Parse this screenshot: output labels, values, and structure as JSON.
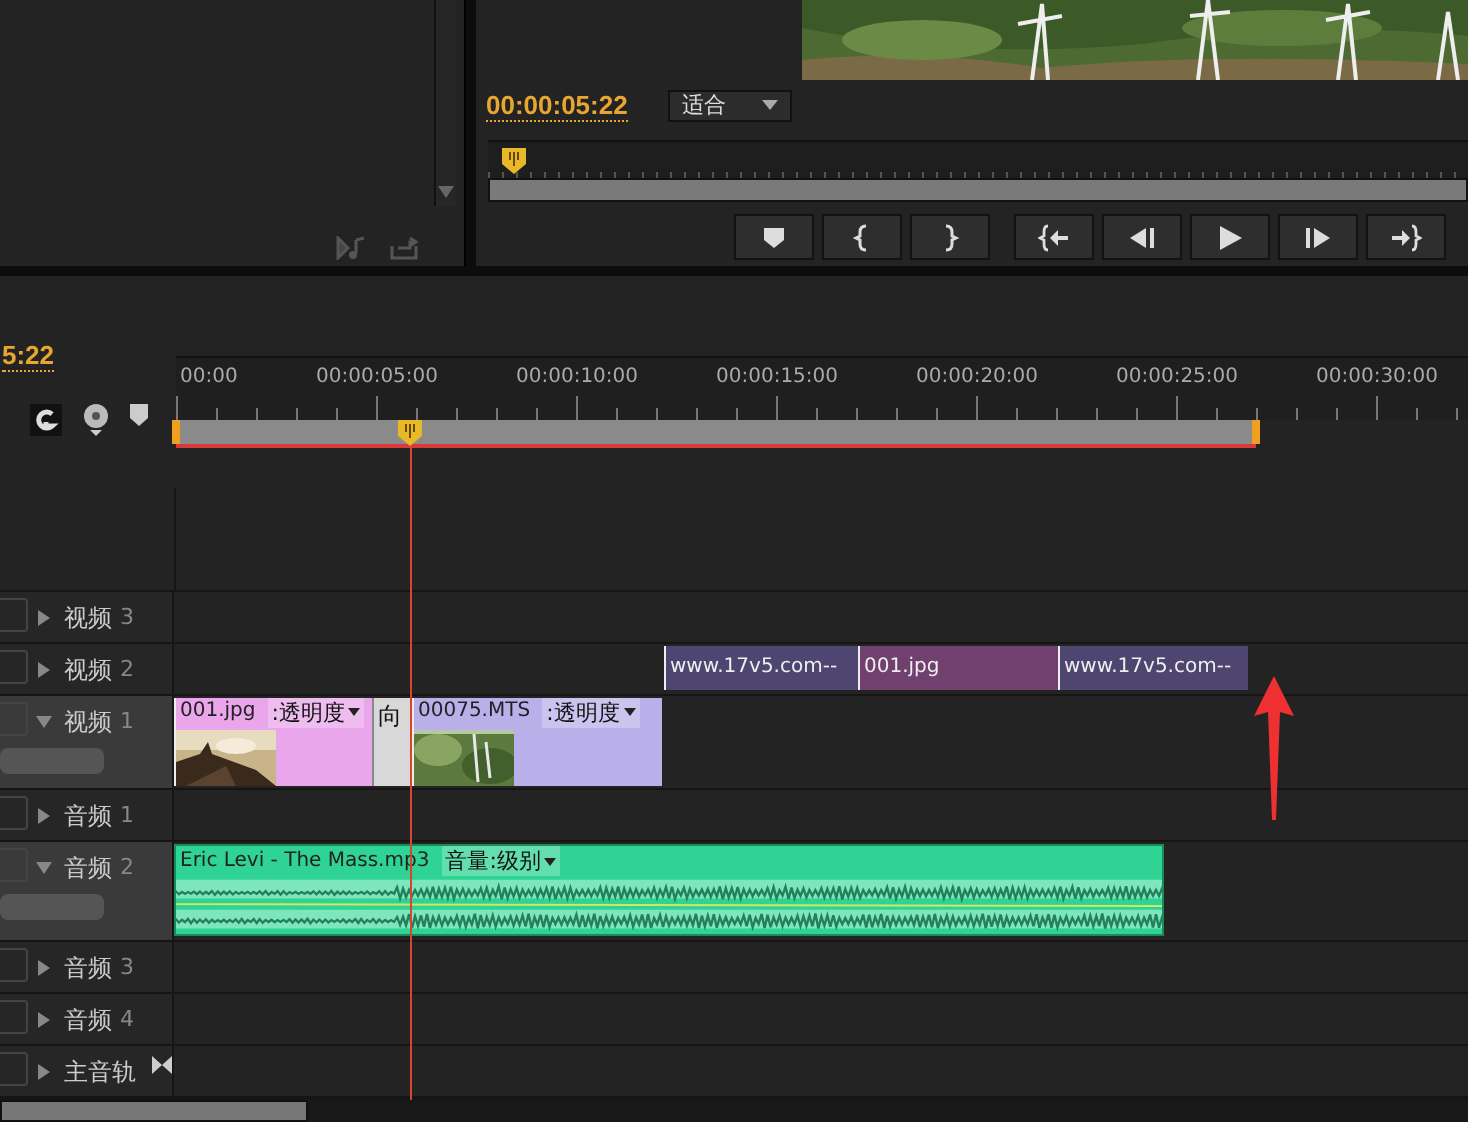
{
  "program_monitor": {
    "timecode": "00:00:05:22",
    "zoom_select": "适合",
    "playhead": {
      "level": 0.015
    },
    "transport_buttons": [
      {
        "kind": "marker"
      },
      {
        "kind": "mark-in"
      },
      {
        "kind": "mark-out"
      },
      {
        "kind": "go-to-in"
      },
      {
        "kind": "step-back"
      },
      {
        "kind": "play"
      },
      {
        "kind": "step-forward"
      },
      {
        "kind": "go-to-out"
      }
    ]
  },
  "timeline": {
    "timecode": "5:22",
    "ruler_labels": [
      "00:00",
      "00:00:05:00",
      "00:00:10:00",
      "00:00:15:00",
      "00:00:20:00",
      "00:00:25:00",
      "00:00:30:00"
    ],
    "playhead": {
      "level": 0.181
    },
    "tracks": [
      {
        "name": "视频",
        "index": "3",
        "kind": "video",
        "expanded": false
      },
      {
        "name": "视频",
        "index": "2",
        "kind": "video",
        "expanded": false,
        "clips": [
          {
            "name": "www.17v5.com--",
            "color": "#4e4670"
          },
          {
            "name": "001.jpg",
            "color": "#71406e"
          },
          {
            "name": "www.17v5.com--",
            "color": "#4e4670"
          }
        ]
      },
      {
        "name": "视频",
        "index": "1",
        "kind": "video",
        "expanded": true,
        "clips": [
          {
            "name": "001.jpg",
            "effect": ":透明度",
            "color": "#e9a6ea",
            "thumbnail": true
          },
          {
            "name": "向",
            "kind": "transition",
            "color": "#d8d8d8"
          },
          {
            "name": "00075.MTS",
            "effect": ":透明度",
            "color": "#b9b0ea",
            "thumbnail": true
          }
        ]
      },
      {
        "name": "音频",
        "index": "1",
        "kind": "audio",
        "expanded": false
      },
      {
        "name": "音频",
        "index": "2",
        "kind": "audio",
        "expanded": true,
        "clips": [
          {
            "name": "Eric Levi - The Mass.mp3",
            "effect": "音量:级别",
            "color": "#2fd394"
          }
        ]
      },
      {
        "name": "音频",
        "index": "3",
        "kind": "audio",
        "expanded": false
      },
      {
        "name": "音频",
        "index": "4",
        "kind": "audio",
        "expanded": false
      },
      {
        "name": "主音轨",
        "kind": "master",
        "expanded": false
      }
    ]
  }
}
